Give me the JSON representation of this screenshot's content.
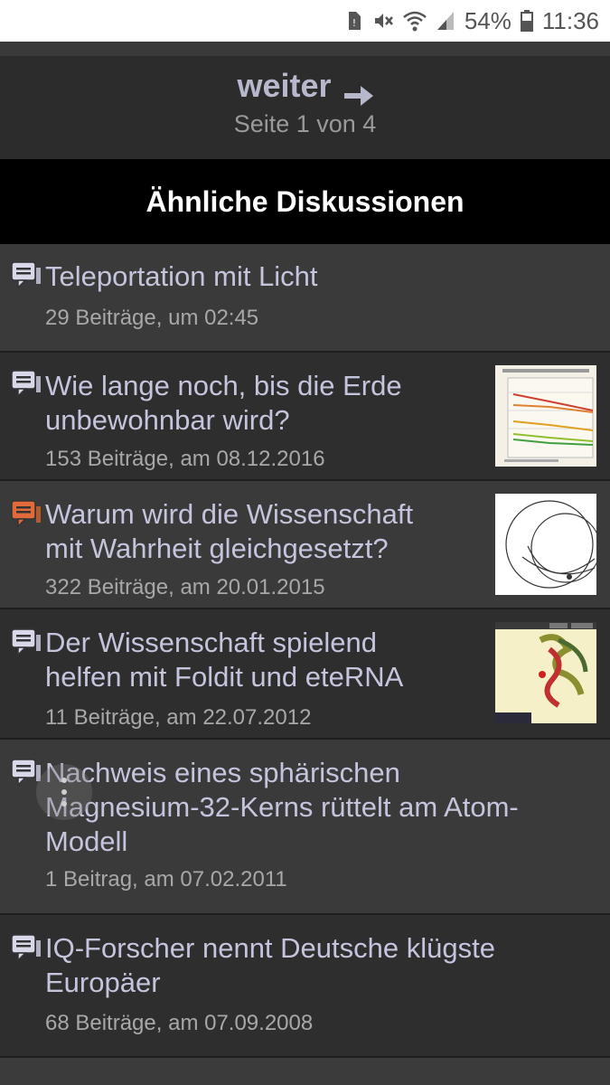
{
  "status_bar": {
    "battery_percent": "54%",
    "time": "11:36",
    "icons": [
      "sim-alert-icon",
      "mute-icon",
      "wifi-icon",
      "signal-icon",
      "battery-icon"
    ]
  },
  "pager": {
    "next_label": "weiter",
    "page_text": "Seite 1 von 4"
  },
  "section": {
    "title": "Ähnliche Diskussionen"
  },
  "discussions": [
    {
      "title": "Teleportation mit Licht",
      "meta": "29 Beiträge, um 02:45",
      "icon_color": "#d8d8e8",
      "has_thumb": false
    },
    {
      "title": "Wie lange noch, bis die Erde\nunbewohnbar wird?",
      "meta": "153 Beiträge, am 08.12.2016",
      "icon_color": "#d8d8e8",
      "has_thumb": true
    },
    {
      "title": "Warum wird die Wissenschaft\nmit Wahrheit gleichgesetzt?",
      "meta": "322 Beiträge, am 20.01.2015",
      "icon_color": "#e06a3a",
      "has_thumb": true
    },
    {
      "title": "Der Wissenschaft spielend\nhelfen mit Foldit und eteRNA",
      "meta": "11 Beiträge, am 22.07.2012",
      "icon_color": "#d8d8e8",
      "has_thumb": true
    },
    {
      "title": "Nachweis eines sphärischen\nMagnesium-32-Kerns rüttelt am Atom-\nModell",
      "meta": "1 Beitrag, am 07.02.2011",
      "icon_color": "#d8d8e8",
      "has_thumb": false
    },
    {
      "title": "IQ-Forscher nennt Deutsche klügste\nEuropäer",
      "meta": "68 Beiträge, am 07.09.2008",
      "icon_color": "#d8d8e8",
      "has_thumb": false
    }
  ],
  "colors": {
    "title_text": "#c4c4dc",
    "accent_icon": "#e06a3a",
    "header_bg": "#000000"
  }
}
